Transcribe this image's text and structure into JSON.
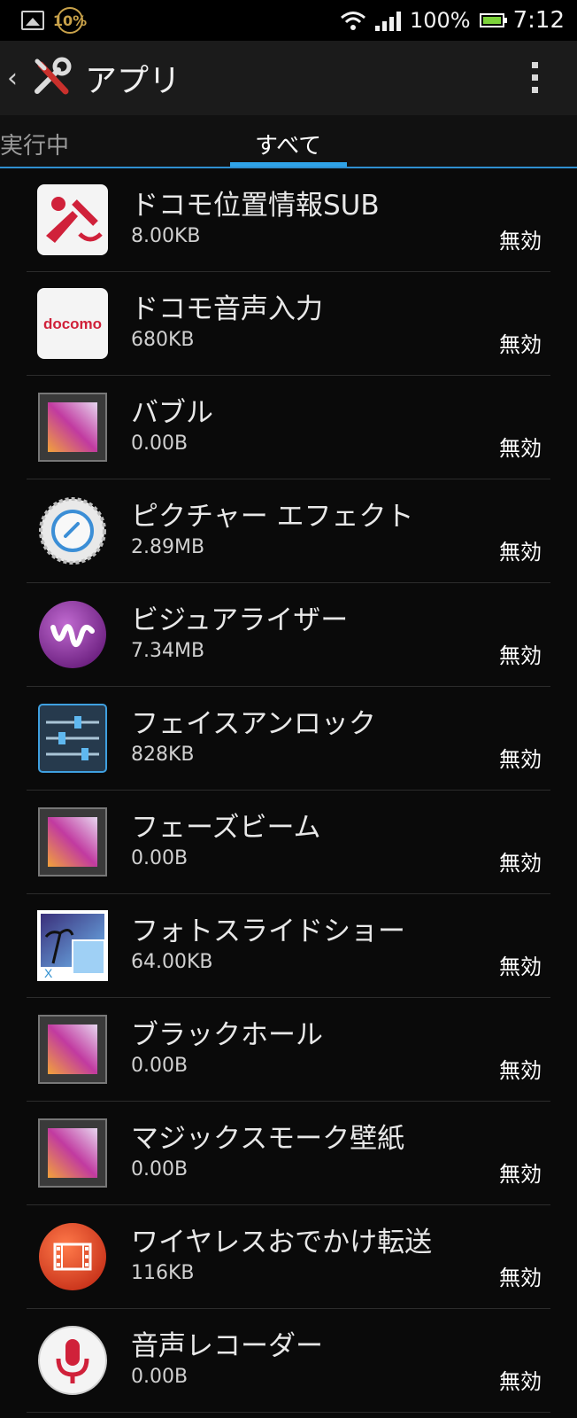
{
  "statusbar": {
    "badge": "10%",
    "battery_percent": "100%",
    "time": "7:12"
  },
  "actionbar": {
    "back_icon": "chevron-left-icon",
    "app_icon": "settings-tools-icon",
    "title": "アプリ",
    "menu_icon": "overflow-menu-icon"
  },
  "tabs": {
    "items": [
      {
        "label": "実行中"
      },
      {
        "label": "すべて"
      }
    ],
    "active_index": 1
  },
  "apps": [
    {
      "name": "ドコモ位置情報SUB",
      "size": "8.00KB",
      "status": "無効",
      "icon": "docomo-location-icon"
    },
    {
      "name": "ドコモ音声入力",
      "size": "680KB",
      "status": "無効",
      "icon": "docomo-logo-icon"
    },
    {
      "name": "バブル",
      "size": "0.00B",
      "status": "無効",
      "icon": "live-wallpaper-icon"
    },
    {
      "name": "ピクチャー エフェクト",
      "size": "2.89MB",
      "status": "無効",
      "icon": "picture-effect-icon"
    },
    {
      "name": "ビジュアライザー",
      "size": "7.34MB",
      "status": "無効",
      "icon": "walkman-icon"
    },
    {
      "name": "フェイスアンロック",
      "size": "828KB",
      "status": "無効",
      "icon": "face-unlock-sliders-icon"
    },
    {
      "name": "フェーズビーム",
      "size": "0.00B",
      "status": "無効",
      "icon": "live-wallpaper-icon"
    },
    {
      "name": "フォトスライドショー",
      "size": "64.00KB",
      "status": "無効",
      "icon": "photo-slideshow-icon"
    },
    {
      "name": "ブラックホール",
      "size": "0.00B",
      "status": "無効",
      "icon": "live-wallpaper-icon"
    },
    {
      "name": "マジックスモーク壁紙",
      "size": "0.00B",
      "status": "無効",
      "icon": "live-wallpaper-icon"
    },
    {
      "name": "ワイヤレスおでかけ転送",
      "size": "116KB",
      "status": "無効",
      "icon": "film-transfer-icon"
    },
    {
      "name": "音声レコーダー",
      "size": "0.00B",
      "status": "無効",
      "icon": "voice-recorder-icon"
    }
  ],
  "colors": {
    "accent": "#2fa3e8",
    "background": "#0a0a0a",
    "battery": "#7cd23a"
  }
}
